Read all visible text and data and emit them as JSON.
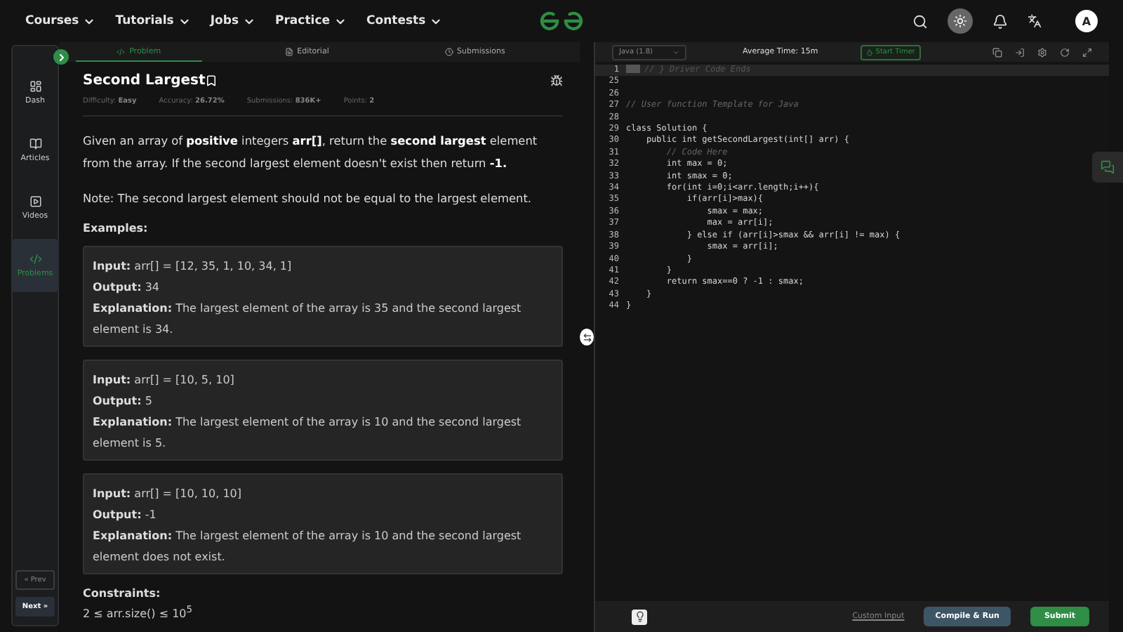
{
  "nav": {
    "menus": [
      "Courses",
      "Tutorials",
      "Jobs",
      "Practice",
      "Contests"
    ],
    "avatar": "A"
  },
  "sidebar": {
    "items": [
      {
        "label": "Dash",
        "selected": false
      },
      {
        "label": "Articles",
        "selected": false
      },
      {
        "label": "Videos",
        "selected": false
      },
      {
        "label": "Problems",
        "selected": true
      }
    ],
    "prev": "« Prev",
    "next": "Next »"
  },
  "tabs": [
    {
      "label": "Problem",
      "selected": true
    },
    {
      "label": "Editorial",
      "selected": false
    },
    {
      "label": "Submissions",
      "selected": false
    }
  ],
  "problem": {
    "title": "Second Largest",
    "meta": [
      {
        "label": "Difficulty:",
        "value": "Easy"
      },
      {
        "label": "Accuracy:",
        "value": "26.72%"
      },
      {
        "label": "Submissions:",
        "value": "836K+"
      },
      {
        "label": "Points:",
        "value": "2"
      }
    ],
    "description": "Given an array of **positive** integers **arr[]**, return the **second largest** element from the array. If the second largest element doesn't exist then return **-1.**",
    "note": "Note: The second largest element should not be equal to the largest element.",
    "examples_heading": "Examples:",
    "examples": [
      {
        "input_label": "Input:",
        "input": "arr[] = [12, 35, 1, 10, 34, 1]",
        "output_label": "Output:",
        "output": "34",
        "explanation_label": "Explanation:",
        "explanation": "The largest element of the array is 35 and the second largest element is 34."
      },
      {
        "input_label": "Input:",
        "input": "arr[] = [10, 5, 10]",
        "output_label": "Output:",
        "output": "5",
        "explanation_label": "Explanation:",
        "explanation": "The largest element of the array is 10 and the second largest element is 5."
      },
      {
        "input_label": "Input:",
        "input": "arr[] = [10, 10, 10]",
        "output_label": "Output:",
        "output": "-1",
        "explanation_label": "Explanation:",
        "explanation": "The largest element of the array is 10 and the second largest element does not exist."
      }
    ],
    "constraints_heading": "Constraints:",
    "constraint": "2 ≤ arr.size() ≤ 10$^{5}$"
  },
  "editor": {
    "language": "Java (1.8)",
    "average_time": "Average Time: 15m",
    "timer": "Start Timer",
    "lines": [
      {
        "n": "1",
        "kind": "folded",
        "text": "// } Driver Code Ends"
      },
      {
        "n": "25"
      },
      {
        "n": "26"
      },
      {
        "n": "27",
        "kind": "comment",
        "text": "// User function Template for Java"
      },
      {
        "n": "28"
      },
      {
        "n": "29",
        "kind": "code",
        "text": "class Solution {"
      },
      {
        "n": "30",
        "kind": "code",
        "text": "    public int getSecondLargest(int[] arr) {"
      },
      {
        "n": "31",
        "kind": "comment",
        "text": "        // Code Here"
      },
      {
        "n": "32",
        "kind": "code",
        "text": "        int max = 0;"
      },
      {
        "n": "33",
        "kind": "code",
        "text": "        int smax = 0;"
      },
      {
        "n": "34",
        "kind": "code",
        "text": "        for(int i=0;i<arr.length;i++){"
      },
      {
        "n": "35",
        "kind": "code",
        "text": "            if(arr[i]>max){"
      },
      {
        "n": "36",
        "kind": "code",
        "text": "                smax = max;"
      },
      {
        "n": "37",
        "kind": "code",
        "text": "                max = arr[i];"
      },
      {
        "n": "38",
        "kind": "code",
        "text": "            } else if (arr[i]>smax && arr[i] != max) {"
      },
      {
        "n": "39",
        "kind": "code",
        "text": "                smax = arr[i];"
      },
      {
        "n": "40",
        "kind": "code",
        "text": "            }"
      },
      {
        "n": "41",
        "kind": "code",
        "text": "        }"
      },
      {
        "n": "42",
        "kind": "code",
        "text": "        return smax==0 ? -1 : smax;"
      },
      {
        "n": "43",
        "kind": "code",
        "text": "    }"
      },
      {
        "n": "44",
        "kind": "code",
        "text": "}"
      }
    ],
    "custom_input": "Custom Input",
    "compile": "Compile & Run",
    "submit": "Submit"
  }
}
